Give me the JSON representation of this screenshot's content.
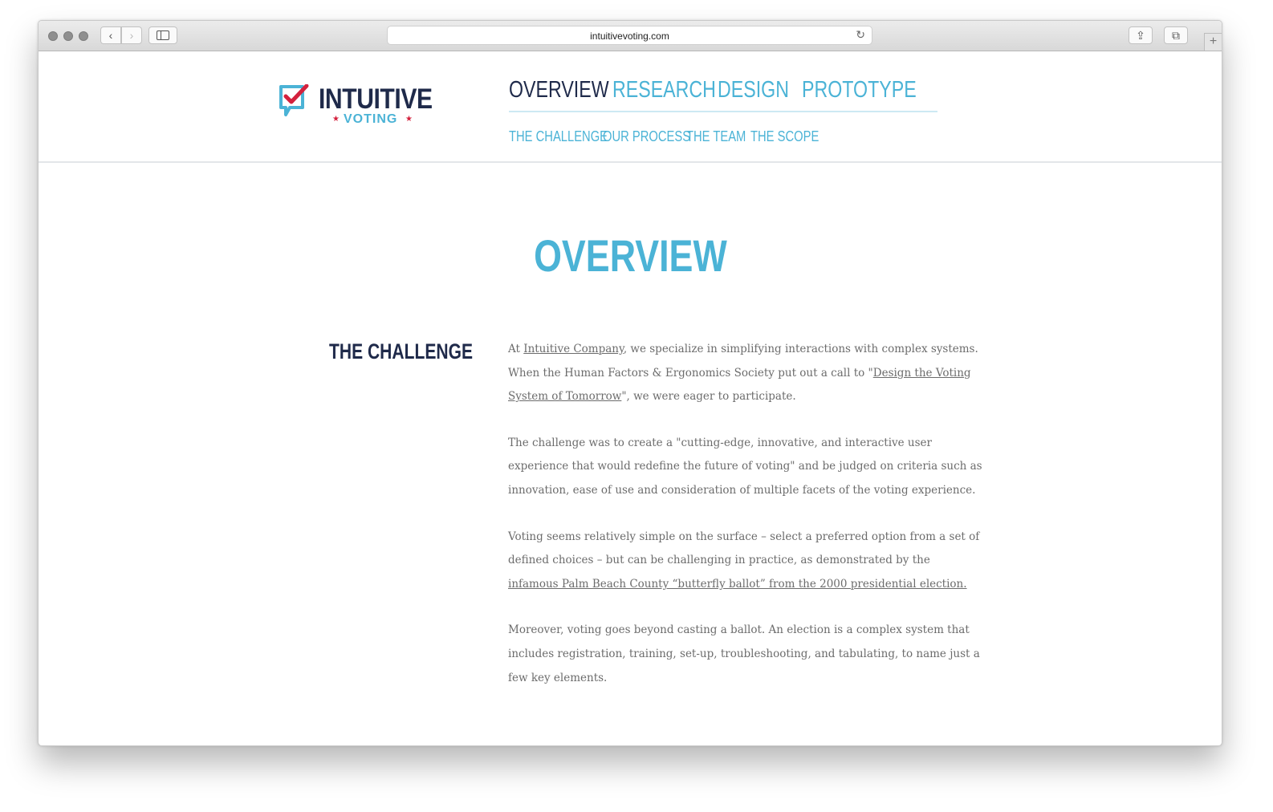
{
  "browser": {
    "url": "intuitivevoting.com",
    "back_glyph": "‹",
    "forward_glyph": "›",
    "reload_glyph": "↻",
    "share_glyph": "⇪",
    "tabs_glyph": "⧉",
    "new_tab_glyph": "+"
  },
  "logo": {
    "word1": "INTUITIVE",
    "word2": "VOTING",
    "star": "★",
    "colors": {
      "navy": "#1f2a4a",
      "blue": "#4bb3d6",
      "red": "#d4213d"
    }
  },
  "nav": {
    "main": [
      {
        "label": "OVERVIEW",
        "active": true
      },
      {
        "label": "RESEARCH"
      },
      {
        "label": "DESIGN"
      },
      {
        "label": "PROTOTYPE"
      }
    ],
    "sub": [
      "THE CHALLENGE",
      "OUR PROCESS",
      "THE TEAM",
      "THE SCOPE"
    ]
  },
  "page": {
    "title": "OVERVIEW",
    "section_title": "THE CHALLENGE",
    "paragraphs": [
      {
        "p1_a": "At ",
        "p1_link1": "Intuitive Company",
        "p1_b": ", we specialize in simplifying interactions with complex systems. When the Human Factors & Ergonomics Society put out a call to \"",
        "p1_link2": "Design the Voting System of Tomorrow",
        "p1_c": "\", we were eager to participate."
      }
    ],
    "p2": "The challenge was to create a \"cutting-edge, innovative, and interactive user experience that would redefine the future of voting\" and be judged on criteria such as innovation, ease of use and consideration of multiple facets of the voting experience.",
    "p3_a": "Voting seems relatively simple on the surface – select a preferred option from a set of defined choices – but can be challenging in practice, as demonstrated by the ",
    "p3_link": "infamous Palm Beach County “butterfly ballot” from the 2000 presidential election.",
    "p4": "Moreover, voting goes beyond casting a ballot. An election is a complex system that includes registration, training, set-up, troubleshooting, and tabulating, to name just a few key elements."
  }
}
